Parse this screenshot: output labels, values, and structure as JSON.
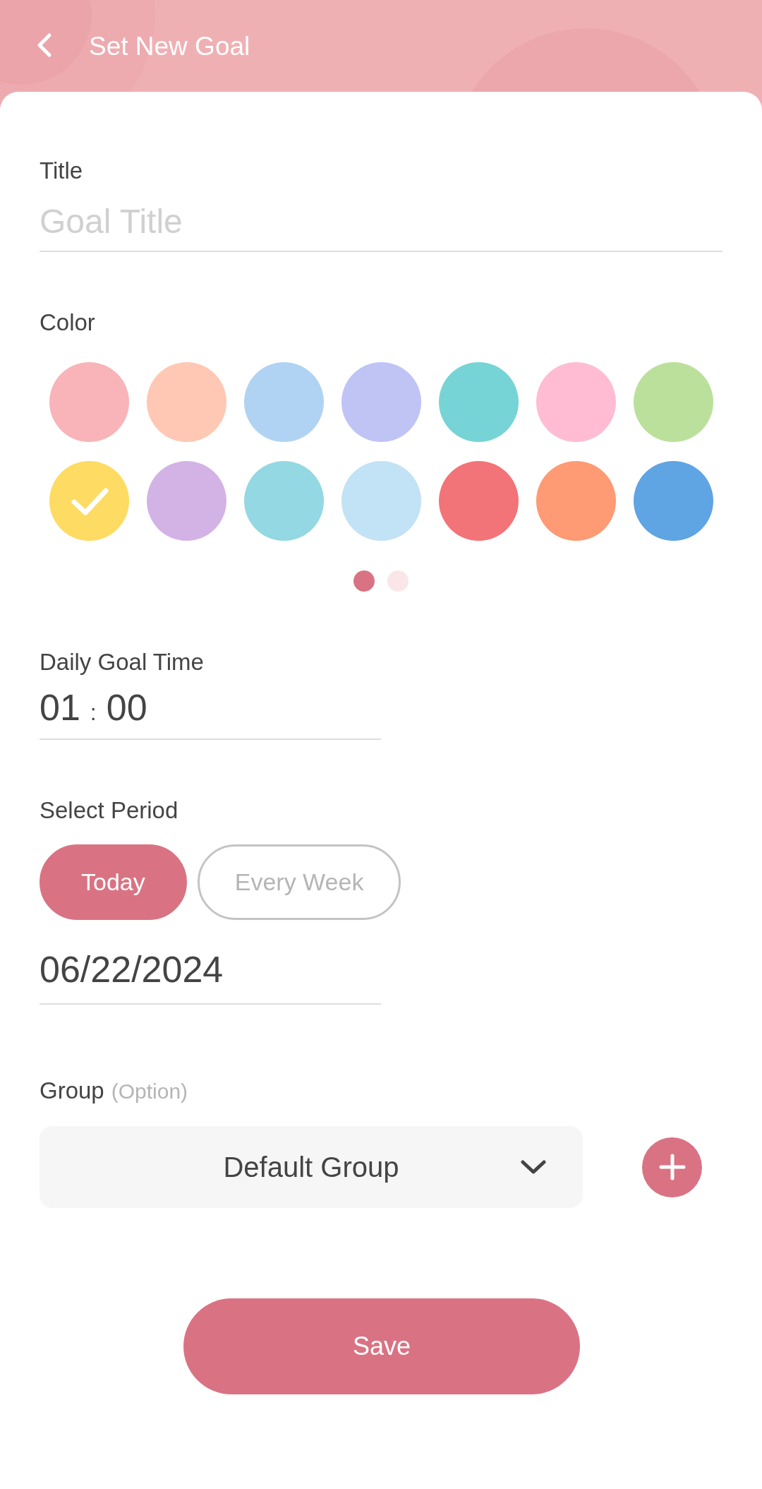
{
  "header": {
    "title": "Set New Goal"
  },
  "title_label": "Title",
  "title_field": {
    "placeholder": "Goal Title"
  },
  "color_label": "Color",
  "colors": [
    {
      "color": "#f8b4b8",
      "selected": false
    },
    {
      "color": "#fec8b4",
      "selected": false
    },
    {
      "color": "#b0d3f3",
      "selected": false
    },
    {
      "color": "#bfc4f5",
      "selected": false
    },
    {
      "color": "#76d4d6",
      "selected": false
    },
    {
      "color": "#ffbcd2",
      "selected": false
    },
    {
      "color": "#bbe09b",
      "selected": false
    },
    {
      "color": "#fedb62",
      "selected": true
    },
    {
      "color": "#d3b3e6",
      "selected": false
    },
    {
      "color": "#93d8e2",
      "selected": false
    },
    {
      "color": "#c2e2f5",
      "selected": false
    },
    {
      "color": "#f27378",
      "selected": false
    },
    {
      "color": "#fe9a74",
      "selected": false
    },
    {
      "color": "#5fa4e3",
      "selected": false
    }
  ],
  "color_pages": [
    {
      "selected": true
    },
    {
      "selected": false
    }
  ],
  "daily_goal_label": "Daily Goal Time",
  "time": {
    "hours": "01",
    "separator": ":",
    "minutes": "00"
  },
  "period_label": "Select Period",
  "periods": [
    {
      "label": "Today",
      "selected": true
    },
    {
      "label": "Every Week",
      "selected": false
    }
  ],
  "date": "06/22/2024",
  "group_label": "Group",
  "group_hint": "(Option)",
  "group_select": {
    "value": "Default Group"
  },
  "save": "Save"
}
